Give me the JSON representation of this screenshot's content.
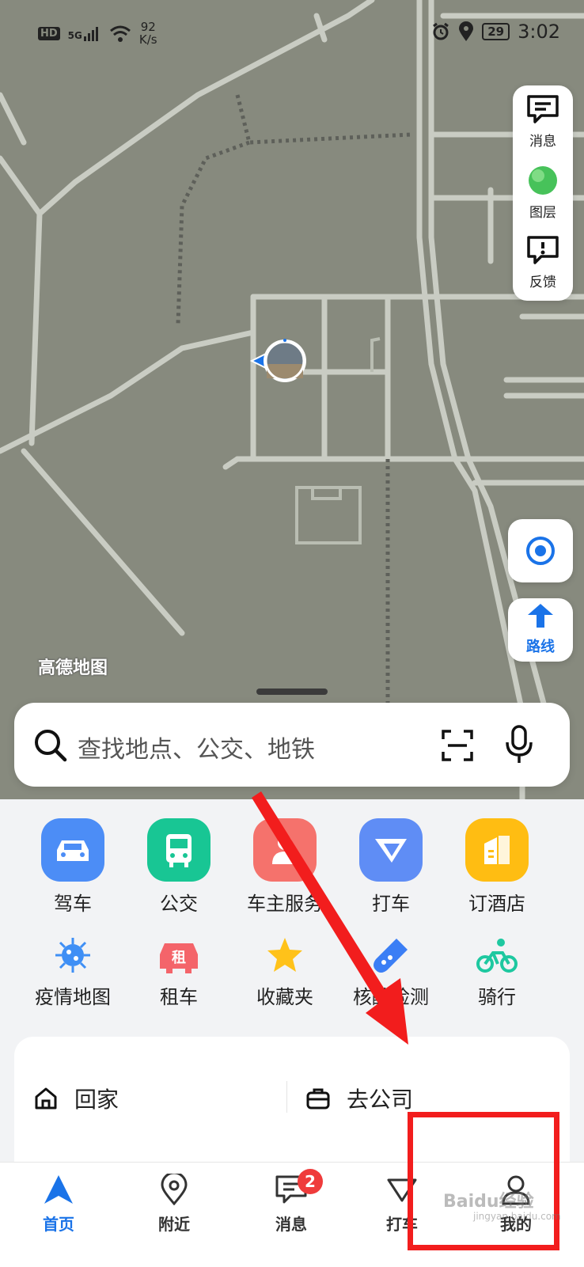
{
  "status_bar": {
    "hd": "HD",
    "signal": "5G",
    "speed_value": "92",
    "speed_unit": "K/s",
    "battery": "29",
    "time": "3:02"
  },
  "map": {
    "provider_logo": "高德地图"
  },
  "side_panel": {
    "messages_label": "消息",
    "layers_label": "图层",
    "feedback_label": "反馈"
  },
  "route_button": {
    "label": "路线"
  },
  "search": {
    "placeholder": "查找地点、公交、地铁"
  },
  "services": [
    {
      "label": "驾车",
      "icon": "car-icon",
      "color": "#4c8df6"
    },
    {
      "label": "公交",
      "icon": "bus-icon",
      "color": "#18c694"
    },
    {
      "label": "车主服务",
      "icon": "car-owner-icon",
      "color": "#f5726c"
    },
    {
      "label": "打车",
      "icon": "taxi-icon",
      "color": "#5f8df5"
    },
    {
      "label": "订酒店",
      "icon": "hotel-icon",
      "color": "#ffbd12"
    },
    {
      "label": "疫情地图",
      "icon": "virus-icon",
      "color": "#3f8ff5"
    },
    {
      "label": "租车",
      "icon": "rent-car-icon",
      "color": "#f4646a"
    },
    {
      "label": "收藏夹",
      "icon": "star-icon",
      "color": "#ffc21a"
    },
    {
      "label": "核酸检测",
      "icon": "test-tube-icon",
      "color": "#3b7ef5"
    },
    {
      "label": "骑行",
      "icon": "bicycle-icon",
      "color": "#1ec8a0"
    }
  ],
  "quick_destinations": {
    "home_label": "回家",
    "work_label": "去公司"
  },
  "tab_bar": {
    "home": "首页",
    "nearby": "附近",
    "messages": "消息",
    "messages_badge": "2",
    "taxi": "打车",
    "mine": "我的"
  },
  "watermark": {
    "text": "Baidu经验",
    "sub": "jingyan.baidu.com"
  }
}
